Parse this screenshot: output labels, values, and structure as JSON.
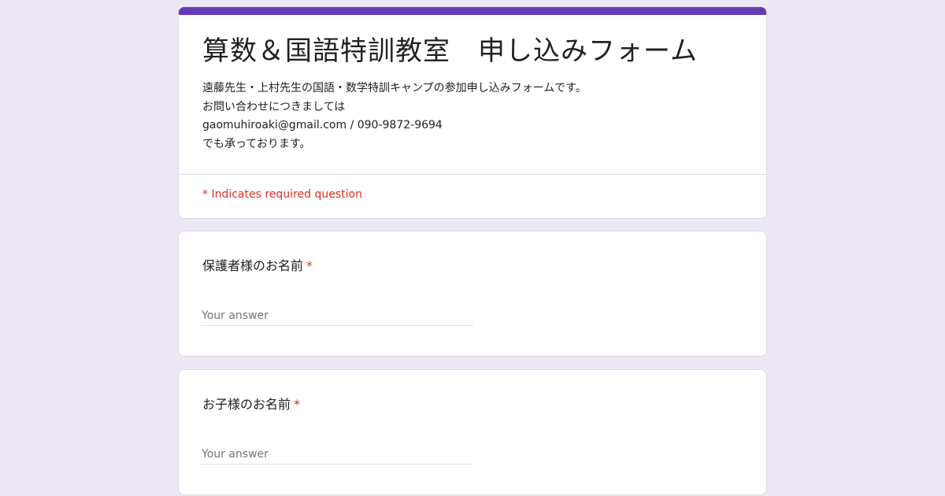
{
  "form": {
    "title": "算数＆国語特訓教室　申し込みフォーム",
    "description_lines": [
      "遠藤先生・上村先生の国語・数学特訓キャンプの参加申し込みフォームです。",
      "お問い合わせにつきましては",
      "gaomuhiroaki@gmail.com / 090-9872-9694",
      "でも承っております。"
    ],
    "required_note": "* Indicates required question",
    "accent_color": "#673ab7",
    "background_color": "#ede7f6",
    "required_color": "#d93025"
  },
  "questions": [
    {
      "label": "保護者様のお名前",
      "required_mark": "*",
      "placeholder": "Your answer"
    },
    {
      "label": "お子様のお名前",
      "required_mark": "*",
      "placeholder": "Your answer"
    }
  ]
}
